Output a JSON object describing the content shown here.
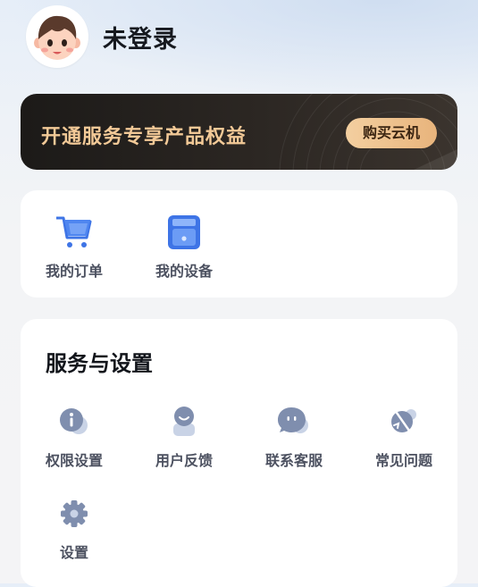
{
  "profile": {
    "login_status": "未登录"
  },
  "banner": {
    "text": "开通服务专享产品权益",
    "button_label": "购买云机"
  },
  "quick_actions": [
    {
      "label": "我的订单",
      "icon": "cart-icon"
    },
    {
      "label": "我的设备",
      "icon": "device-box-icon"
    }
  ],
  "services": {
    "title": "服务与设置",
    "items": [
      {
        "label": "权限设置",
        "icon": "info-icon"
      },
      {
        "label": "用户反馈",
        "icon": "feedback-person-icon"
      },
      {
        "label": "联系客服",
        "icon": "chat-bubble-icon"
      },
      {
        "label": "常见问题",
        "icon": "question-icon"
      },
      {
        "label": "设置",
        "icon": "gear-icon"
      }
    ]
  },
  "colors": {
    "banner_text": "#f2c997",
    "button_bg": "#e8b47c",
    "icon_blue": "#3e74e6",
    "icon_grey": "#7f8eae"
  }
}
